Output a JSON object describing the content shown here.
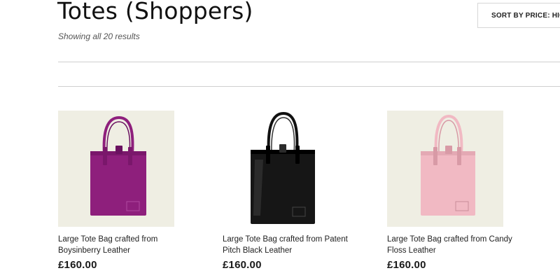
{
  "header": {
    "title": "Totes (Shoppers)",
    "result_count": "Showing all 20 results",
    "sort_label": "SORT BY PRICE: HIGH TO LOW"
  },
  "products": [
    {
      "name": "Large Tote Bag crafted from Boysinberry Leather",
      "price": "£160.00",
      "color": "#8e1f7c",
      "color_dark": "#6a1160",
      "thumb_bg": "#efeee3"
    },
    {
      "name": "Large Tote Bag crafted from Patent Pitch Black Leather",
      "price": "£160.00",
      "color": "#161616",
      "color_dark": "#000000",
      "thumb_bg": "#ffffff"
    },
    {
      "name": "Large Tote Bag crafted from Candy Floss Leather",
      "price": "£160.00",
      "color": "#f1b9c3",
      "color_dark": "#d89aa6",
      "thumb_bg": "#efeee3"
    }
  ]
}
